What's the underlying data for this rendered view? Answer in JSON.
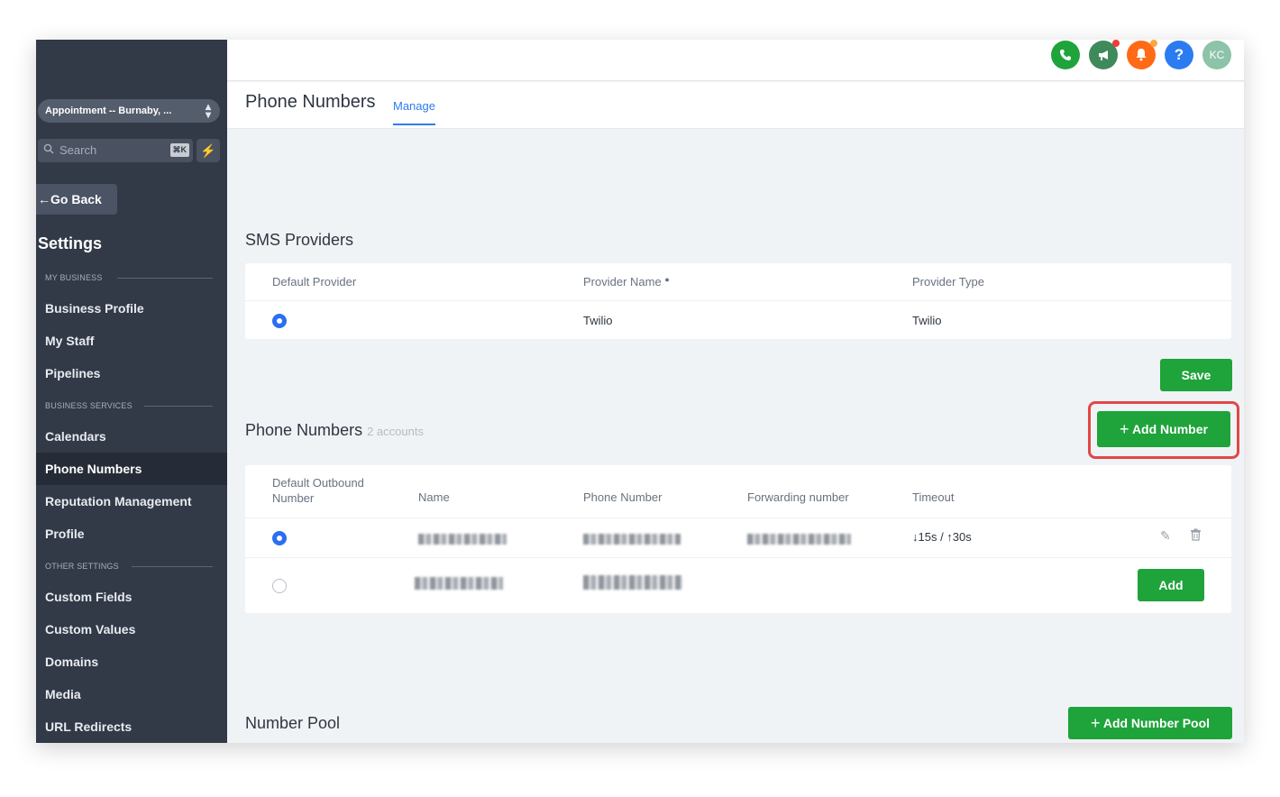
{
  "sidebar": {
    "location": "Appointment -- Burnaby, ...",
    "location_chevron": "⌃⌄",
    "search_placeholder": "Search",
    "search_shortcut": "⌘K",
    "go_back": "Go Back",
    "settings_title": "Settings",
    "sections": [
      {
        "label": "MY BUSINESS",
        "items": [
          "Business Profile",
          "My Staff",
          "Pipelines"
        ]
      },
      {
        "label": "BUSINESS SERVICES",
        "items": [
          "Calendars",
          "Phone Numbers",
          "Reputation Management",
          "Profile"
        ]
      },
      {
        "label": "OTHER SETTINGS",
        "items": [
          "Custom Fields",
          "Custom Values",
          "Domains",
          "Media",
          "URL Redirects"
        ]
      }
    ],
    "active_item": "Phone Numbers"
  },
  "topbar": {
    "avatar_initials": "KC",
    "help_label": "?",
    "icons": [
      "phone-icon",
      "megaphone-icon",
      "bell-icon",
      "help-icon",
      "avatar"
    ]
  },
  "header": {
    "title": "Phone Numbers",
    "tabs": [
      {
        "label": "Manage",
        "active": true
      }
    ]
  },
  "sms_providers": {
    "title": "SMS Providers",
    "columns": [
      "Default Provider",
      "Provider Name",
      "Provider Type"
    ],
    "rows": [
      {
        "default": true,
        "provider_name": "Twilio",
        "provider_type": "Twilio"
      }
    ],
    "save_label": "Save"
  },
  "phone_numbers": {
    "title": "Phone Numbers",
    "count_label": "2 accounts",
    "add_button": "Add Number",
    "columns": [
      "Default Outbound Number",
      "Name",
      "Phone Number",
      "Forwarding number",
      "Timeout"
    ],
    "rows": [
      {
        "default": true,
        "timeout": "↓15s / ↑30s"
      },
      {
        "default": false,
        "action_label": "Add"
      }
    ]
  },
  "number_pool": {
    "title": "Number Pool",
    "add_button": "Add Number Pool"
  },
  "colors": {
    "sidebar_bg": "#323a48",
    "accent_blue": "#2b7cf0",
    "green": "#1fa33b",
    "highlight_red": "#e24747"
  }
}
